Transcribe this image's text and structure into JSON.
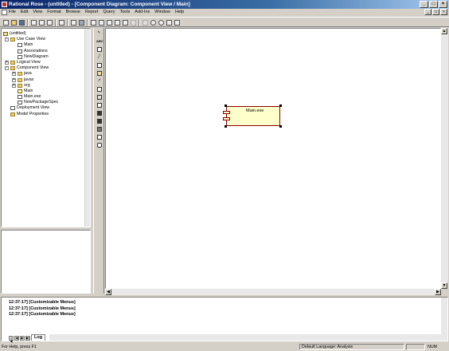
{
  "window": {
    "title": "Rational Rose - (untitled) - [Component Diagram: Component View / Main]",
    "minimize": "_",
    "maximize": "□",
    "close": "×"
  },
  "menubar": {
    "items": [
      "File",
      "Edit",
      "View",
      "Format",
      "Browse",
      "Report",
      "Query",
      "Tools",
      "Add-Ins",
      "Window",
      "Help"
    ]
  },
  "browser": {
    "nodes": [
      {
        "label": "(untitled)",
        "icon": "model-icon",
        "expander": "",
        "level": 0
      },
      {
        "label": "Use Case View",
        "icon": "folder-icon",
        "expander": "-",
        "level": 1
      },
      {
        "label": "Main",
        "icon": "diagram-icon",
        "expander": "",
        "level": 2
      },
      {
        "label": "Associations",
        "icon": "diagram-icon",
        "expander": "",
        "level": 2
      },
      {
        "label": "NewDiagram",
        "icon": "diagram-icon",
        "expander": "",
        "level": 2
      },
      {
        "label": "Logical View",
        "icon": "folder-icon",
        "expander": "+",
        "level": 1
      },
      {
        "label": "Component View",
        "icon": "folder-icon",
        "expander": "-",
        "level": 1
      },
      {
        "label": "java",
        "icon": "package-icon",
        "expander": "+",
        "level": 2
      },
      {
        "label": "javax",
        "icon": "package-icon",
        "expander": "+",
        "level": 2
      },
      {
        "label": "org",
        "icon": "package-icon",
        "expander": "+",
        "level": 2
      },
      {
        "label": "Main",
        "icon": "component-diagram-icon",
        "expander": "",
        "level": 2
      },
      {
        "label": "Main.exe",
        "icon": "component-icon",
        "expander": "",
        "level": 2
      },
      {
        "label": "NewPackageSpec",
        "icon": "component-icon",
        "expander": "",
        "level": 2
      },
      {
        "label": "Deployment View",
        "icon": "diagram-icon",
        "expander": "",
        "level": 1
      },
      {
        "label": "Model Properties",
        "icon": "folder-icon",
        "expander": "",
        "level": 1
      }
    ]
  },
  "toolbox": {
    "tools": [
      "selection-tool-icon",
      "text-tool-icon",
      "note-tool-icon",
      "anchor-tool-icon",
      "package-tool-icon",
      "dependency-tool-icon",
      "component-tool-icon",
      "subprogram-spec-icon",
      "subprogram-body-icon",
      "generic-package-icon",
      "task-spec-icon",
      "task-body-icon",
      "database-icon",
      "main-program-icon"
    ],
    "abc_label": "ABC"
  },
  "diagram": {
    "component_name": "Main.exe"
  },
  "log": {
    "lines": [
      "12:37:17]  [Customizable Menus]",
      "12:37:17]  [Customizable Menus]",
      "12:37:17]  [Customizable Menus]"
    ],
    "tab_label": "Log"
  },
  "status": {
    "help": "For Help, press F1",
    "language": "Default Language: Analysis",
    "num": "NUM"
  }
}
